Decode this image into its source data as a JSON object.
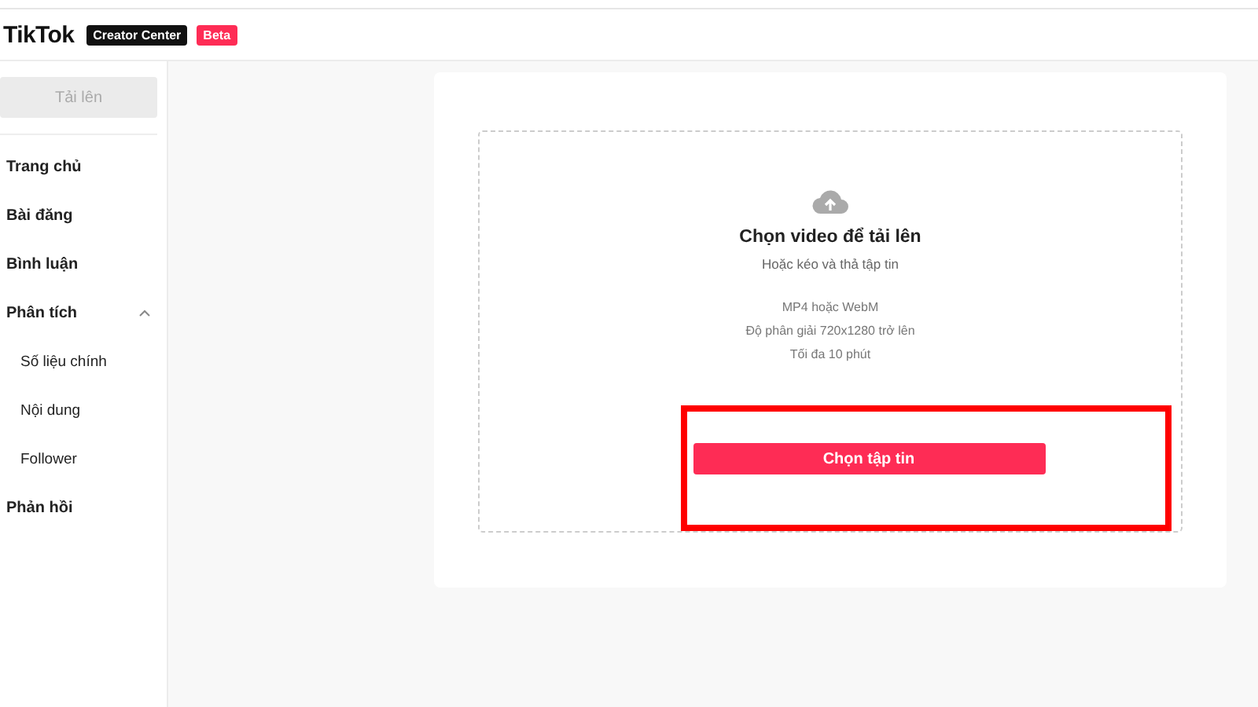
{
  "header": {
    "logo": "TikTok",
    "product_badge": "Creator Center",
    "beta_badge": "Beta"
  },
  "sidebar": {
    "upload_button": {
      "label": "Tải lên",
      "disabled": true
    },
    "items": [
      {
        "label": "Trang chủ"
      },
      {
        "label": "Bài đăng"
      },
      {
        "label": "Bình luận"
      },
      {
        "label": "Phân tích",
        "expanded": true,
        "children": [
          {
            "label": "Số liệu chính"
          },
          {
            "label": "Nội dung"
          },
          {
            "label": "Follower"
          }
        ]
      },
      {
        "label": "Phản hồi"
      }
    ]
  },
  "upload": {
    "title": "Chọn video để tải lên",
    "subtitle": "Hoặc kéo và thả tập tin",
    "requirements": [
      "MP4 hoặc WebM",
      "Độ phân giải 720x1280 trở lên",
      "Tối đa 10 phút"
    ],
    "button": "Chọn tập tin",
    "highlighted": true
  }
}
